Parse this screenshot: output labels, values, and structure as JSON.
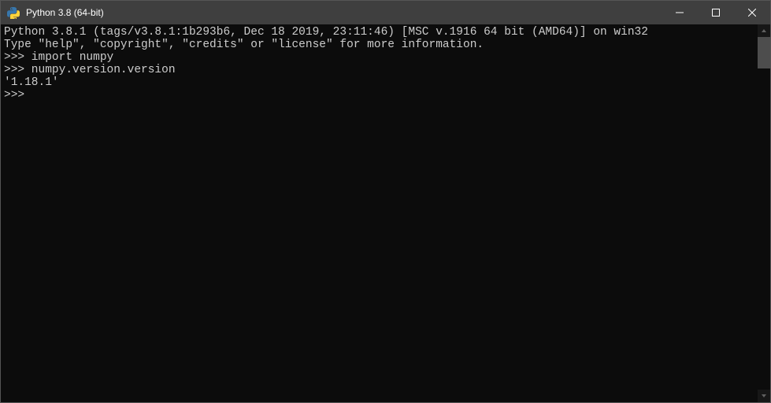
{
  "window": {
    "title": "Python 3.8 (64-bit)"
  },
  "terminal": {
    "lines": [
      "Python 3.8.1 (tags/v3.8.1:1b293b6, Dec 18 2019, 23:11:46) [MSC v.1916 64 bit (AMD64)] on win32",
      "Type \"help\", \"copyright\", \"credits\" or \"license\" for more information.",
      ">>> import numpy",
      ">>> numpy.version.version",
      "'1.18.1'",
      ">>> "
    ]
  }
}
